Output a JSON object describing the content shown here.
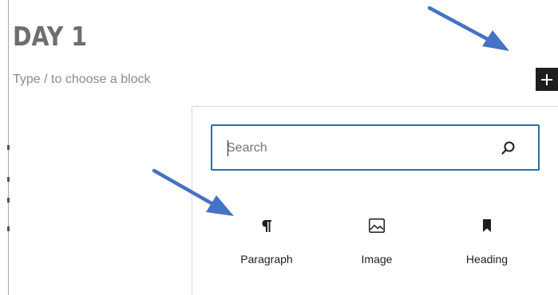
{
  "editor": {
    "title": "DAY 1",
    "placeholder": "Type / to choose a block"
  },
  "toolbar": {
    "add_block_icon": "plus-icon"
  },
  "inserter": {
    "search": {
      "placeholder": "Search",
      "value": ""
    },
    "blocks": [
      {
        "label": "Paragraph",
        "icon": "paragraph-icon"
      },
      {
        "label": "Image",
        "icon": "image-icon"
      },
      {
        "label": "Heading",
        "icon": "bookmark-icon"
      }
    ]
  },
  "colors": {
    "accent": "#2271b1",
    "annotation_arrow": "#4472c4",
    "button_dark": "#1e1e1e",
    "title": "#6e6e6e"
  }
}
